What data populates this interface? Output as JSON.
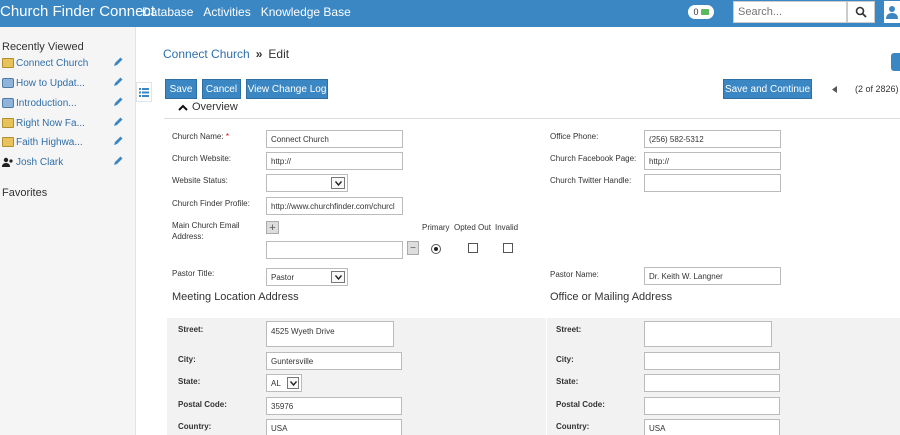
{
  "topbar": {
    "brand": "Church Finder Connect",
    "nav": [
      "Database",
      "Activities",
      "Knowledge Base"
    ],
    "toggle_count": "0",
    "search_placeholder": "Search..."
  },
  "sidebar": {
    "recent_title": "Recently Viewed",
    "items": [
      {
        "label": "Connect Church",
        "icon": "folder-icon"
      },
      {
        "label": "How to Updat...",
        "icon": "document-icon"
      },
      {
        "label": "Introduction...",
        "icon": "document-icon"
      },
      {
        "label": "Right Now Fa...",
        "icon": "folder-icon"
      },
      {
        "label": "Faith Highwa...",
        "icon": "folder-icon"
      },
      {
        "label": "Josh Clark",
        "icon": "contact-icon"
      }
    ],
    "favorites_title": "Favorites"
  },
  "breadcrumb": {
    "parent": "Connect Church",
    "separator": "»",
    "current": "Edit"
  },
  "toolbar": {
    "save": "Save",
    "cancel": "Cancel",
    "change_log": "View Change Log",
    "save_continue": "Save and Continue",
    "pager": "(2 of 2826)"
  },
  "section": {
    "overview": "Overview"
  },
  "form": {
    "church_name": {
      "label": "Church Name:",
      "req": "*",
      "value": "Connect Church"
    },
    "church_website": {
      "label": "Church Website:",
      "value": "http://"
    },
    "website_status": {
      "label": "Website Status:",
      "value": ""
    },
    "finder_profile": {
      "label": "Church Finder Profile:",
      "value": "http://www.churchfinder.com/churcl"
    },
    "main_email": {
      "label": "Main Church Email Address:",
      "value": ""
    },
    "email_cols": {
      "primary": "Primary",
      "opted_out": "Opted Out",
      "invalid": "Invalid"
    },
    "pastor_title": {
      "label": "Pastor Title:",
      "value": "Pastor"
    },
    "office_phone": {
      "label": "Office Phone:",
      "value": "(256) 582-5312"
    },
    "facebook": {
      "label": "Church Facebook Page:",
      "value": "http://"
    },
    "twitter": {
      "label": "Church Twitter Handle:",
      "value": ""
    },
    "pastor_name": {
      "label": "Pastor Name:",
      "value": "Dr. Keith W. Langner"
    }
  },
  "meeting": {
    "title": "Meeting Location Address",
    "street": {
      "label": "Street:",
      "value": "4525 Wyeth Drive"
    },
    "city": {
      "label": "City:",
      "value": "Guntersville"
    },
    "state": {
      "label": "State:",
      "value": "AL"
    },
    "postal": {
      "label": "Postal Code:",
      "value": "35976"
    },
    "country": {
      "label": "Country:",
      "value": "USA"
    }
  },
  "mailing": {
    "title": "Office or Mailing Address",
    "street": {
      "label": "Street:",
      "value": ""
    },
    "city": {
      "label": "City:",
      "value": ""
    },
    "state": {
      "label": "State:",
      "value": ""
    },
    "postal": {
      "label": "Postal Code:",
      "value": ""
    },
    "country": {
      "label": "Country:",
      "value": "USA"
    }
  },
  "colors": {
    "accent": "#3a87c4",
    "link": "#2f6fab",
    "required": "#dd0000"
  }
}
